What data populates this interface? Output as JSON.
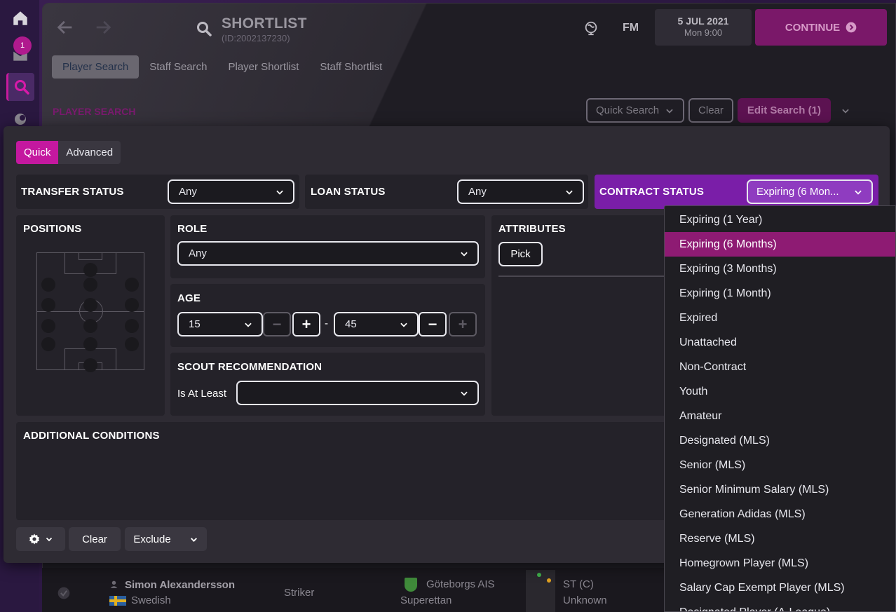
{
  "sidebar": {
    "inbox_badge": "1"
  },
  "header": {
    "title": "SHORTLIST",
    "subtitle": "(ID:2002137230)",
    "fm_label": "FM",
    "date": "5 JUL 2021",
    "time": "Mon 9:00",
    "continue_label": "CONTINUE",
    "tabs": [
      "Player Search",
      "Staff Search",
      "Player Shortlist",
      "Staff Shortlist"
    ],
    "section_label": "PLAYER SEARCH",
    "quick_search_label": "Quick Search",
    "clear_label": "Clear",
    "edit_search_label": "Edit Search (1)"
  },
  "panel": {
    "mode_quick": "Quick",
    "mode_advanced": "Advanced",
    "transfer_status": {
      "label": "TRANSFER STATUS",
      "value": "Any"
    },
    "loan_status": {
      "label": "LOAN STATUS",
      "value": "Any"
    },
    "contract_status": {
      "label": "CONTRACT STATUS",
      "value": "Expiring (6 Mon..."
    },
    "positions_label": "POSITIONS",
    "role": {
      "label": "ROLE",
      "value": "Any"
    },
    "attributes": {
      "label": "ATTRIBUTES",
      "pick_label": "Pick"
    },
    "age": {
      "label": "AGE",
      "min": "15",
      "max": "45",
      "separator": "-",
      "minus": "−",
      "plus": "+"
    },
    "scout": {
      "label": "SCOUT RECOMMENDATION",
      "prefix": "Is At Least",
      "value": ""
    },
    "additional_label": "ADDITIONAL CONDITIONS",
    "bottom": {
      "clear_label": "Clear",
      "exclude_label": "Exclude"
    }
  },
  "contract_menu": {
    "items": [
      "Expiring (1 Year)",
      "Expiring (6 Months)",
      "Expiring (3 Months)",
      "Expiring (1 Month)",
      "Expired",
      "Unattached",
      "Non-Contract",
      "Youth",
      "Amateur",
      "Designated (MLS)",
      "Senior (MLS)",
      "Senior Minimum Salary (MLS)",
      "Generation Adidas (MLS)",
      "Reserve (MLS)",
      "Homegrown Player (MLS)",
      "Salary Cap Exempt Player (MLS)",
      "Designated Player (A-League)"
    ],
    "selected_index": 1
  },
  "list_row": {
    "player_name": "Simon Alexandersson",
    "nationality": "Swedish",
    "position": "Striker",
    "club": "Göteborgs AIS",
    "league": "Superettan",
    "pos_code": "ST (C)",
    "status": "Unknown"
  },
  "colors": {
    "accent": "#c4189f",
    "contract": "#7a1ea8",
    "menu_selected": "#8e1b73"
  }
}
